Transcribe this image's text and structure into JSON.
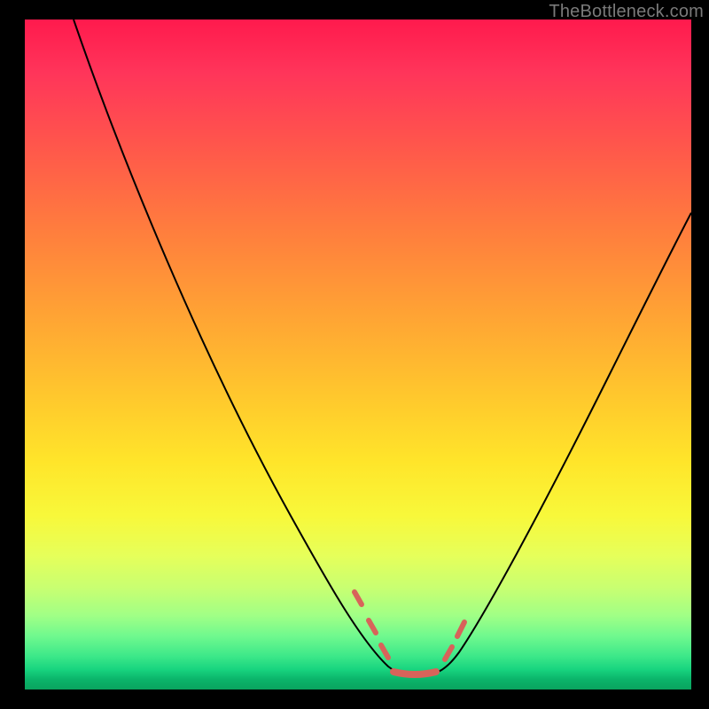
{
  "watermark": "TheBottleneck.com",
  "chart_data": {
    "type": "line",
    "title": "",
    "xlabel": "",
    "ylabel": "",
    "xlim": [
      0,
      100
    ],
    "ylim": [
      0,
      100
    ],
    "grid": false,
    "legend": false,
    "annotations": [],
    "series": [
      {
        "name": "bottleneck-curve",
        "color": "#000000",
        "x": [
          7,
          12,
          18,
          24,
          30,
          36,
          42,
          46,
          50,
          52,
          54,
          56,
          57,
          58,
          60,
          62,
          64,
          66,
          70,
          76,
          82,
          88,
          94,
          100
        ],
        "y": [
          100,
          88,
          76,
          64,
          52,
          40,
          30,
          22,
          14,
          10,
          6,
          4,
          3,
          3,
          3,
          4,
          6,
          10,
          18,
          30,
          42,
          54,
          64,
          72
        ]
      }
    ],
    "accent_segments": [
      {
        "name": "left-dash-1",
        "x": [
          49.5,
          50.5
        ],
        "y": [
          15,
          13
        ]
      },
      {
        "name": "left-dash-2",
        "x": [
          51.5,
          52.5
        ],
        "y": [
          11,
          9
        ]
      },
      {
        "name": "left-dash-3",
        "x": [
          53.5,
          54.5
        ],
        "y": [
          7,
          5.5
        ]
      },
      {
        "name": "valley-floor",
        "x": [
          55,
          61
        ],
        "y": [
          3.2,
          3.2
        ]
      },
      {
        "name": "right-dash-1",
        "x": [
          62,
          63.5
        ],
        "y": [
          5,
          8
        ]
      },
      {
        "name": "right-dash-2",
        "x": [
          64,
          65.5
        ],
        "y": [
          9,
          12
        ]
      }
    ],
    "notes": "Single V-shaped curve on a rainbow heat background. No axis ticks, labels, or legend are visible. Values are estimated from pixel positions relative to the plot area (0–100 normalized). Accent segments are the salmon-colored dashes overlaid near the curve's minimum."
  }
}
